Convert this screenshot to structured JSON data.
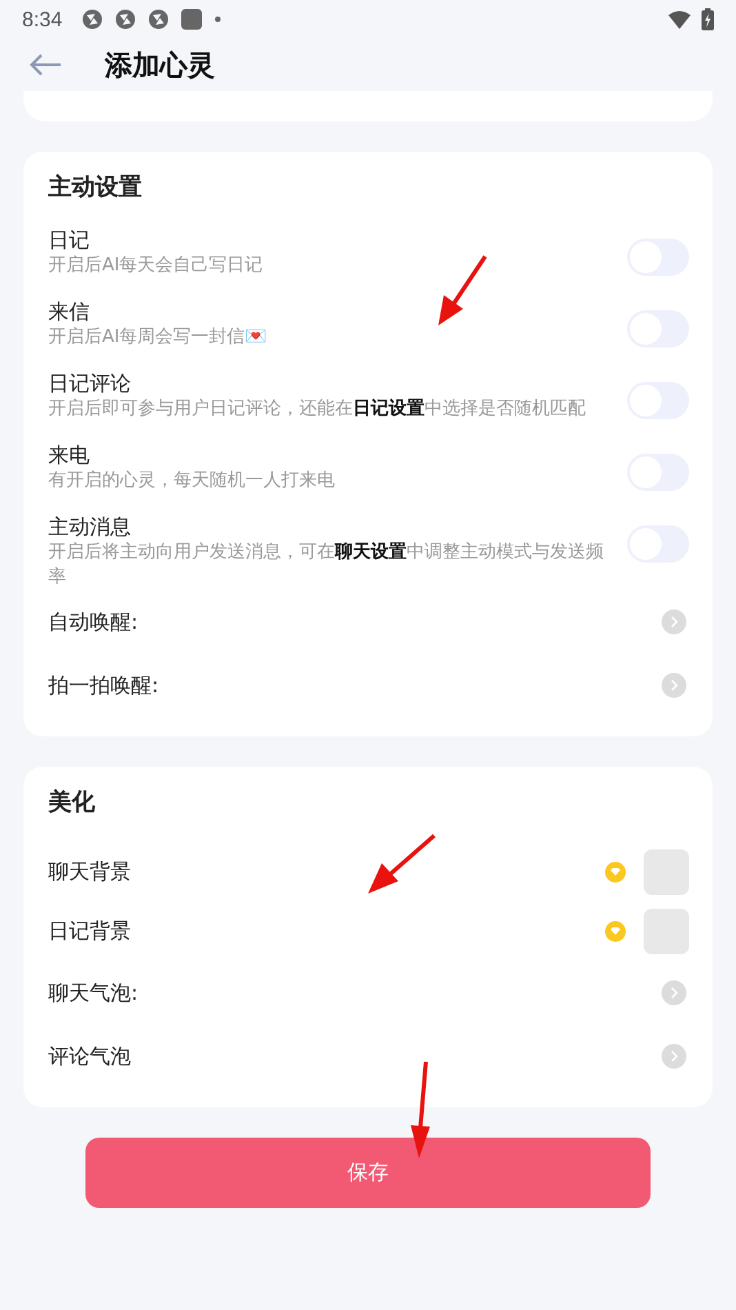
{
  "status_bar": {
    "time": "8:34"
  },
  "header": {
    "title": "添加心灵"
  },
  "sections": [
    {
      "title": "主动设置",
      "rows": [
        {
          "kind": "toggle",
          "label": "日记",
          "description": "开启后AI每天会自己写日记",
          "on": false
        },
        {
          "kind": "toggle",
          "label": "来信",
          "description": "开启后AI每周会写一封信💌",
          "on": false
        },
        {
          "kind": "toggle",
          "label": "日记评论",
          "description": "开启后即可参与用户日记评论，还能在**日记设置**中选择是否随机匹配",
          "on": false
        },
        {
          "kind": "toggle",
          "label": "来电",
          "description": "有开启的心灵，每天随机一人打来电",
          "on": false
        },
        {
          "kind": "toggle",
          "label": "主动消息",
          "description": "开启后将主动向用户发送消息，可在**聊天设置**中调整主动模式与发送频率",
          "on": false
        },
        {
          "kind": "link",
          "label": "自动唤醒:"
        },
        {
          "kind": "link",
          "label": "拍一拍唤醒:"
        }
      ]
    },
    {
      "title": "美化",
      "rows": [
        {
          "kind": "image",
          "label": "聊天背景"
        },
        {
          "kind": "image",
          "label": "日记背景"
        },
        {
          "kind": "link",
          "label": "聊天气泡:"
        },
        {
          "kind": "link",
          "label": "评论气泡"
        }
      ]
    }
  ],
  "save_button": "保存"
}
